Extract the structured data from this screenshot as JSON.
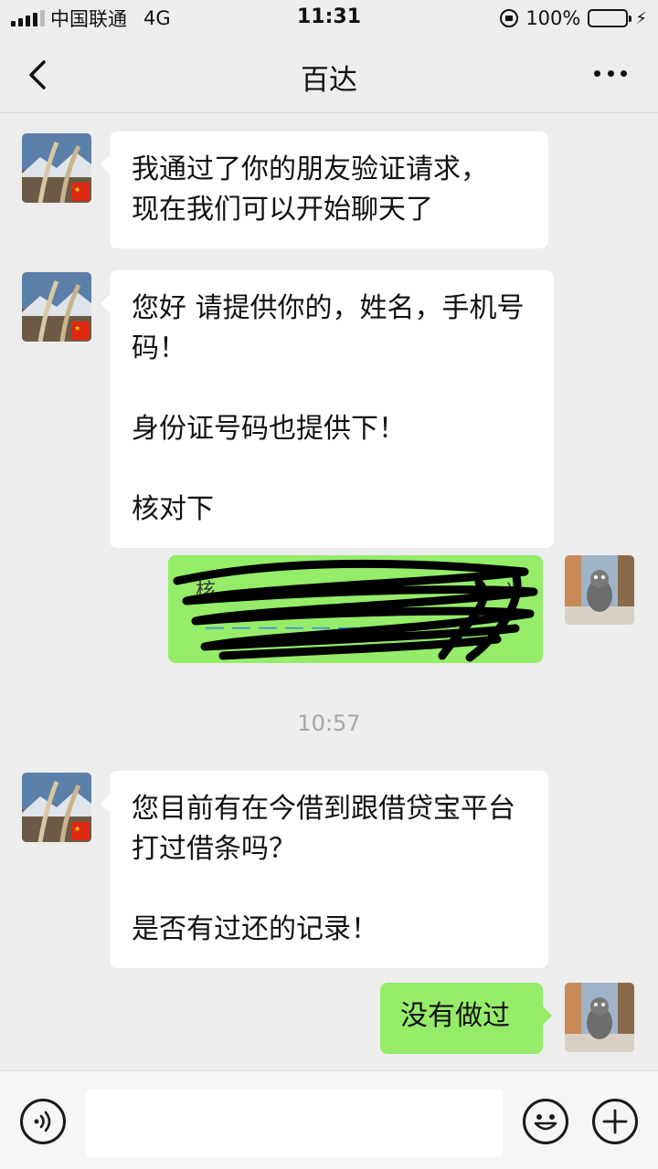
{
  "status_bar": {
    "carrier": "中国联通",
    "network": "4G",
    "time": "11:31",
    "battery": "100%"
  },
  "nav": {
    "title": "百达",
    "back_icon": "chevron-left-icon",
    "more_icon": "more-dots-icon"
  },
  "messages": [
    {
      "side": "left",
      "lines": [
        "我通过了你的朋友验证请求，",
        "现在我们可以开始聊天了"
      ]
    },
    {
      "side": "left",
      "paragraphs": [
        "您好 请提供你的，姓名，手机号码！",
        "身份证号码也提供下！",
        "核对下"
      ]
    },
    {
      "side": "right",
      "type": "redacted-card",
      "note": "scribbled-out"
    },
    {
      "side": "left",
      "paragraphs": [
        "您目前有在今借到跟借贷宝平台打过借条吗？",
        "是否有过还的记录！"
      ]
    },
    {
      "side": "right",
      "text": "没有做过"
    }
  ],
  "timestamp": "10:57",
  "input_bar": {
    "voice_icon": "voice-icon",
    "emoji_icon": "emoji-icon",
    "add_icon": "plus-icon",
    "input_value": ""
  },
  "colors": {
    "background": "#ededed",
    "bubble_left": "#ffffff",
    "bubble_right": "#95ec69",
    "battery": "#4cd964"
  }
}
